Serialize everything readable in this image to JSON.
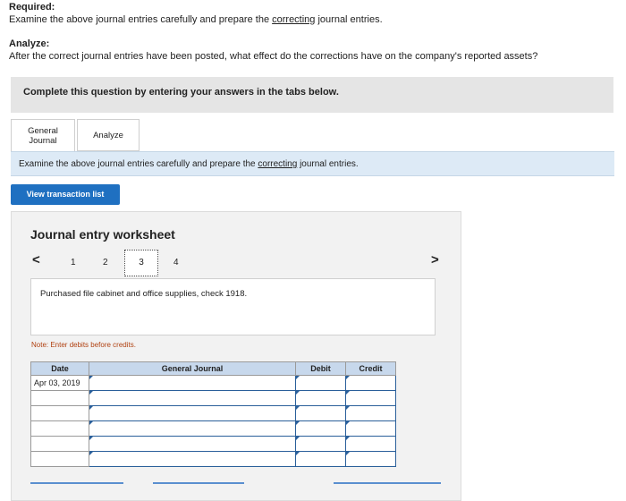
{
  "required": {
    "title": "Required:",
    "text_before": "Examine the above journal entries carefully and prepare the ",
    "text_link": "correcting",
    "text_after": " journal entries."
  },
  "analyze": {
    "title": "Analyze:",
    "text": "After the correct journal entries have been posted, what effect do the corrections have on the company's reported assets?"
  },
  "banner": "Complete this question by entering your answers in the tabs below.",
  "tabs": [
    {
      "label_line1": "General",
      "label_line2": "Journal"
    },
    {
      "label": "Analyze"
    }
  ],
  "info": {
    "before": "Examine the above journal entries carefully and prepare the ",
    "link": "correcting",
    "after": " journal entries."
  },
  "view_button": "View transaction list",
  "worksheet": {
    "title": "Journal entry worksheet",
    "steps": [
      "1",
      "2",
      "3",
      "4"
    ],
    "current_step": "3",
    "description": "Purchased file cabinet and office supplies, check 1918.",
    "note": "Note: Enter debits before credits."
  },
  "table": {
    "headers": [
      "Date",
      "General Journal",
      "Debit",
      "Credit"
    ],
    "first_date": "Apr 03, 2019"
  },
  "colors": {
    "button_blue": "#1f70c1",
    "header_blue": "#c7d8ec",
    "info_blue": "#ddeaf6",
    "note_orange": "#b04010"
  }
}
